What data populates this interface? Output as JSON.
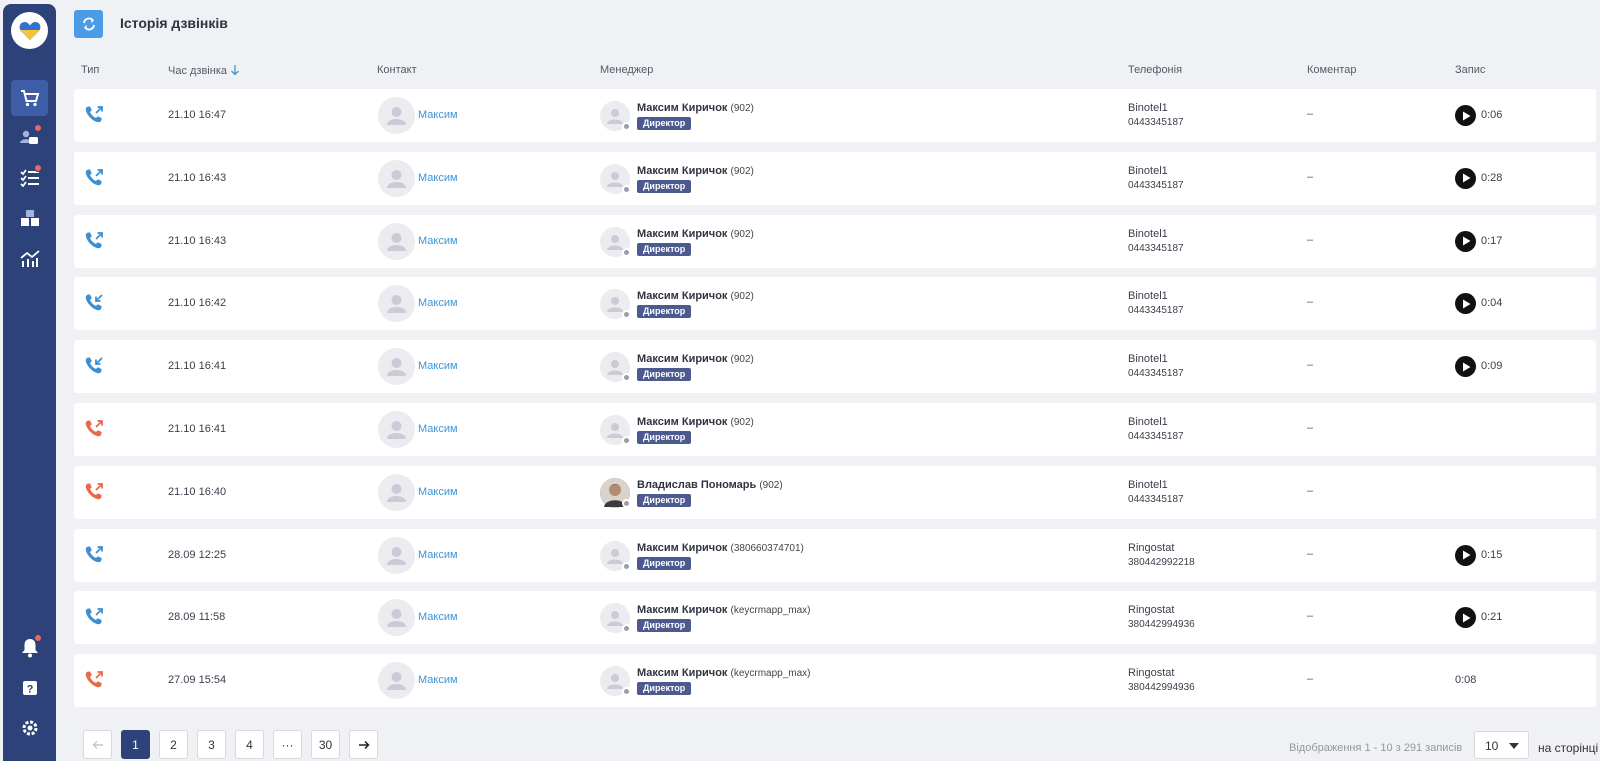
{
  "page_title": "Історія дзвінків",
  "columns": {
    "type": "Тип",
    "time": "Час дзвінка",
    "contact": "Контакт",
    "manager": "Менеджер",
    "telephony": "Телефонія",
    "comment": "Коментар",
    "record": "Запис"
  },
  "colors": {
    "incoming": "#3d8fd1",
    "missed": "#e8694a",
    "accent": "#2c4279",
    "link": "#3d95d4"
  },
  "rows": [
    {
      "direction": "outgoing",
      "status": "answered",
      "time": "21.10 16:47",
      "contact": "Максим",
      "manager": "Максим Киричок",
      "ext": "(902)",
      "role": "Директор",
      "tel_name": "Binotel1",
      "tel_number": "0443345187",
      "comment": "–",
      "has_record": true,
      "duration": "0:06"
    },
    {
      "direction": "outgoing",
      "status": "answered",
      "time": "21.10 16:43",
      "contact": "Максим",
      "manager": "Максим Киричок",
      "ext": "(902)",
      "role": "Директор",
      "tel_name": "Binotel1",
      "tel_number": "0443345187",
      "comment": "–",
      "has_record": true,
      "duration": "0:28"
    },
    {
      "direction": "outgoing",
      "status": "answered",
      "time": "21.10 16:43",
      "contact": "Максим",
      "manager": "Максим Киричок",
      "ext": "(902)",
      "role": "Директор",
      "tel_name": "Binotel1",
      "tel_number": "0443345187",
      "comment": "–",
      "has_record": true,
      "duration": "0:17"
    },
    {
      "direction": "incoming",
      "status": "answered",
      "time": "21.10 16:42",
      "contact": "Максим",
      "manager": "Максим Киричок",
      "ext": "(902)",
      "role": "Директор",
      "tel_name": "Binotel1",
      "tel_number": "0443345187",
      "comment": "–",
      "has_record": true,
      "duration": "0:04"
    },
    {
      "direction": "incoming",
      "status": "answered",
      "time": "21.10 16:41",
      "contact": "Максим",
      "manager": "Максим Киричок",
      "ext": "(902)",
      "role": "Директор",
      "tel_name": "Binotel1",
      "tel_number": "0443345187",
      "comment": "–",
      "has_record": true,
      "duration": "0:09"
    },
    {
      "direction": "outgoing",
      "status": "missed",
      "time": "21.10 16:41",
      "contact": "Максим",
      "manager": "Максим Киричок",
      "ext": "(902)",
      "role": "Директор",
      "tel_name": "Binotel1",
      "tel_number": "0443345187",
      "comment": "–",
      "has_record": false,
      "duration": ""
    },
    {
      "direction": "outgoing",
      "status": "missed",
      "time": "21.10 16:40",
      "contact": "Максим",
      "manager": "Владислав Пономарь",
      "ext": "(902)",
      "role": "Директор",
      "photo": true,
      "tel_name": "Binotel1",
      "tel_number": "0443345187",
      "comment": "–",
      "has_record": false,
      "duration": ""
    },
    {
      "direction": "outgoing",
      "status": "answered",
      "time": "28.09 12:25",
      "contact": "Максим",
      "manager": "Максим Киричок",
      "ext": "(380660374701)",
      "role": "Директор",
      "tel_name": "Ringostat",
      "tel_number": "380442992218",
      "comment": "–",
      "has_record": true,
      "duration": "0:15"
    },
    {
      "direction": "outgoing",
      "status": "answered",
      "time": "28.09 11:58",
      "contact": "Максим",
      "manager": "Максим Киричок",
      "ext": "(keycrmapp_max)",
      "role": "Директор",
      "tel_name": "Ringostat",
      "tel_number": "380442994936",
      "comment": "–",
      "has_record": true,
      "duration": "0:21"
    },
    {
      "direction": "outgoing",
      "status": "missed",
      "time": "27.09 15:54",
      "contact": "Максим",
      "manager": "Максим Киричок",
      "ext": "(keycrmapp_max)",
      "role": "Директор",
      "tel_name": "Ringostat",
      "tel_number": "380442994936",
      "comment": "–",
      "has_record": false,
      "duration": "0:08"
    }
  ],
  "pagination": {
    "pages": [
      "1",
      "2",
      "3",
      "4",
      "···",
      "30"
    ],
    "current": "1",
    "info": "Відображення 1 - 10 з 291 записів",
    "page_size": "10",
    "per_page_label": "на сторінці"
  },
  "sidebar": {
    "items": [
      "cart-icon",
      "clients-icon",
      "tasks-icon",
      "warehouse-icon",
      "analytics-icon"
    ],
    "bottom": [
      "notifications-icon",
      "help-icon",
      "settings-icon"
    ]
  }
}
